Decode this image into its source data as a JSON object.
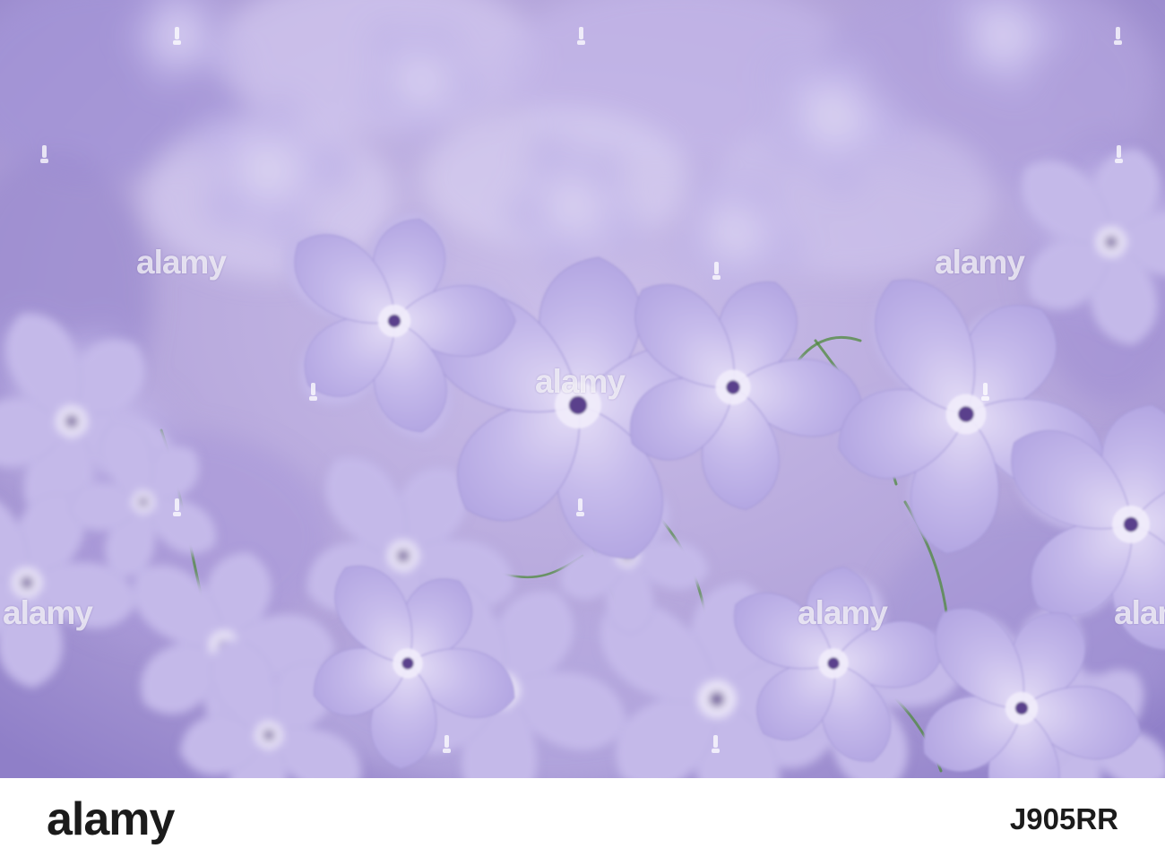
{
  "photo": {
    "subject": "Blue phlox flowers",
    "colors": {
      "petal": "#c2b6e8",
      "petal_light": "#d9d0f2",
      "petal_dark": "#9d8fd4",
      "eye": "#5a3f8c",
      "stem": "#4f8a3c",
      "background": "#b7a8dc"
    }
  },
  "watermarks": {
    "text": "alamy",
    "count": 6
  },
  "footer": {
    "logo": "alamy",
    "image_id": "J905RR"
  }
}
